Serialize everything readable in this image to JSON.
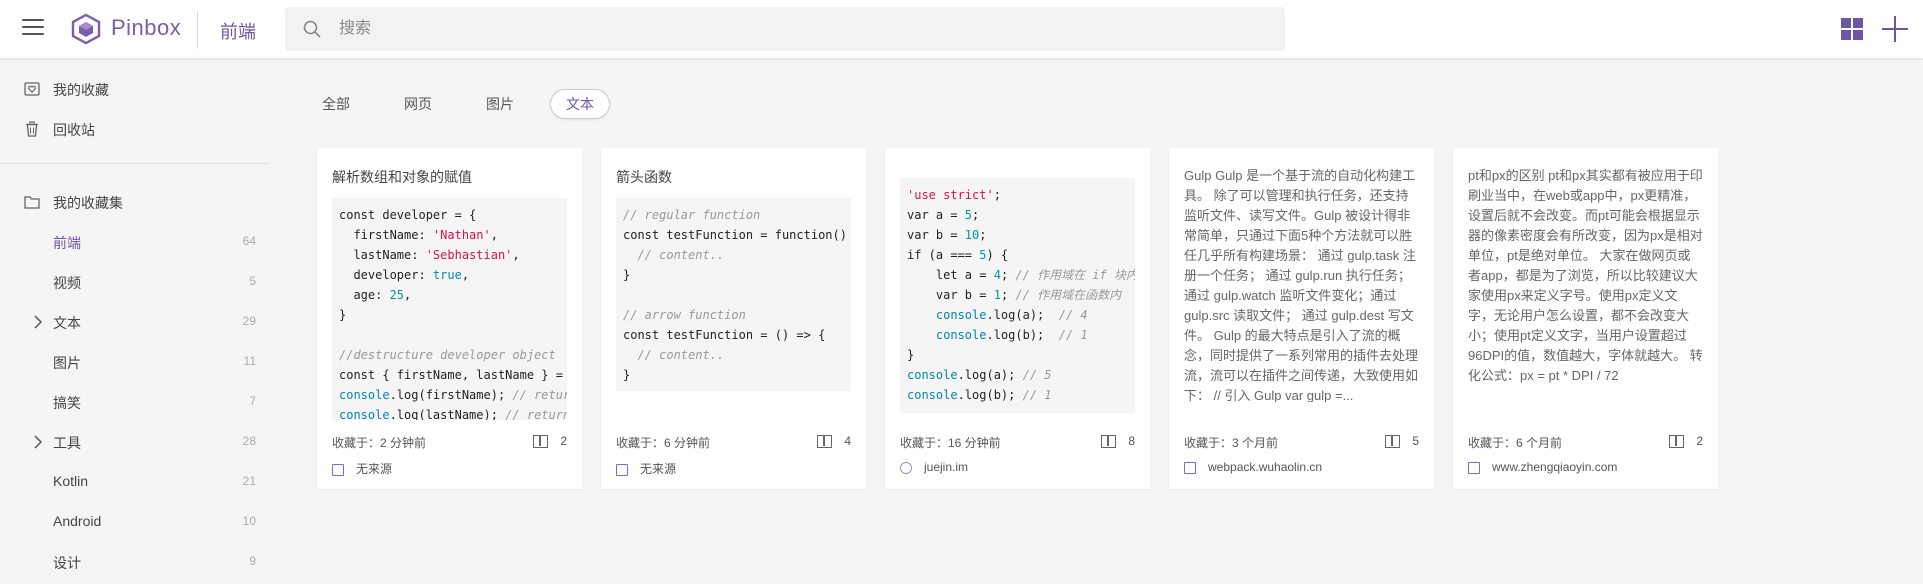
{
  "header": {
    "brand": "Pinbox",
    "current_folder": "前端",
    "search_placeholder": "搜索"
  },
  "sidebar": {
    "top_items": [
      {
        "label": "我的收藏",
        "icon": "heart-icon"
      },
      {
        "label": "回收站",
        "icon": "trash-icon"
      }
    ],
    "collections_label": "我的收藏集",
    "folders": [
      {
        "label": "前端",
        "count": "64",
        "active": true
      },
      {
        "label": "视频",
        "count": "5"
      },
      {
        "label": "文本",
        "count": "29",
        "expandable": true
      },
      {
        "label": "图片",
        "count": "11"
      },
      {
        "label": "搞笑",
        "count": "7"
      },
      {
        "label": "工具",
        "count": "28",
        "expandable": true
      },
      {
        "label": "Kotlin",
        "count": "21"
      },
      {
        "label": "Android",
        "count": "10"
      },
      {
        "label": "设计",
        "count": "9"
      }
    ]
  },
  "filters": [
    {
      "label": "全部"
    },
    {
      "label": "网页"
    },
    {
      "label": "图片"
    },
    {
      "label": "文本",
      "active": true
    }
  ],
  "cards": [
    {
      "title": "解析数组和对象的赋值",
      "time": "收藏于：2 分钟前",
      "count": "2",
      "source": "无来源"
    },
    {
      "title": "箭头函数",
      "time": "收藏于：6 分钟前",
      "count": "4",
      "source": "无来源"
    },
    {
      "title": "",
      "time": "收藏于：16 分钟前",
      "count": "8",
      "source": "juejin.im"
    },
    {
      "text": "Gulp Gulp 是一个基于流的自动化构建工具。 除了可以管理和执行任务，还支持监听文件、读写文件。Gulp 被设计得非常简单，只通过下面5种个方法就可以胜任几乎所有构建场景： 通过 gulp.task 注册一个任务； 通过 gulp.run 执行任务； 通过 gulp.watch 监听文件变化；通过 gulp.src 读取文件； 通过 gulp.dest 写文件。 Gulp 的最大特点是引入了流的概念，同时提供了一系列常用的插件去处理流，流可以在插件之间传递，大致使用如下： // 引入 Gulp var gulp =...",
      "time": "收藏于：3 个月前",
      "count": "5",
      "source": "webpack.wuhaolin.cn"
    },
    {
      "text": "pt和px的区别 pt和px其实都有被应用于印刷业当中，在web或app中，px更精准，设置后就不会改变。而pt可能会根据显示器的像素密度会有所改变，因为px是相对单位，pt是绝对单位。 大家在做网页或者app，都是为了浏览，所以比较建议大家使用px来定义字号。使用px定义文字，无论用户怎么设置，都不会改变大小；使用pt定义文字，当用户设置超过96DPI的值，数值越大，字体就越大。 转化公式：px = pt * DPI / 72",
      "time": "收藏于：6 个月前",
      "count": "2",
      "source": "www.zhengqiaoyin.com"
    }
  ],
  "code": {
    "card1": [
      "const developer = {",
      "  firstName: ",
      "'Nathan'",
      ",",
      "  lastName: ",
      "'Sebhastian'",
      ",",
      "  developer: ",
      "true",
      ",",
      "  age: ",
      "25",
      ",",
      "}",
      "",
      "//destructure developer object",
      "const { firstName, lastName } = developer;",
      "console",
      ".log(firstName); ",
      "// returns 'Nathan'",
      "console",
      ".log(lastName); ",
      "// returns 'Sebhastian'"
    ],
    "card2": [
      "// regular function",
      "const testFunction = function() {",
      "  // content..",
      "}",
      "",
      "// arrow function",
      "const testFunction = () => {",
      "  // content..",
      "}"
    ],
    "card3": [
      "'use strict'",
      ";",
      "var a = ",
      "5",
      ";",
      "var b = ",
      "10",
      ";",
      "if (a === ",
      "5",
      ") {",
      "    let a = ",
      "4",
      "; ",
      "// 作用域在 if 块内",
      "    var b = ",
      "1",
      "; ",
      "// 作用域在函数内",
      "    console",
      ".log(a);  ",
      "// 4",
      "    console",
      ".log(b);  ",
      "// 1",
      "}",
      "console",
      ".log(a); ",
      "// 5",
      "console",
      ".log(b); ",
      "// 1"
    ]
  }
}
